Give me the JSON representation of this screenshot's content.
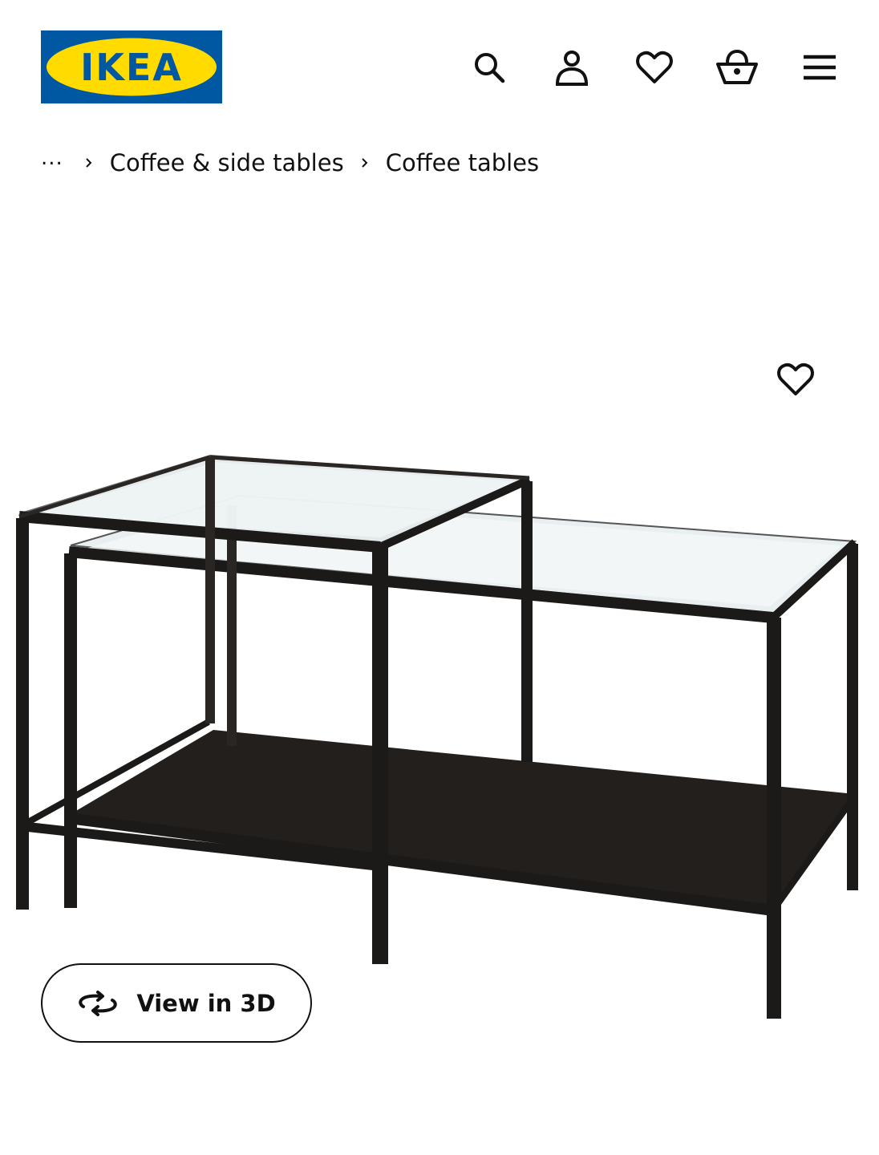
{
  "header": {
    "logo_text": "IKEA",
    "brand_colors": {
      "blue": "#0058a3",
      "yellow": "#ffdb00"
    },
    "icons": [
      "search-icon",
      "account-icon",
      "heart-icon",
      "basket-icon",
      "menu-icon"
    ]
  },
  "breadcrumb": {
    "ellipsis": "...",
    "items": [
      {
        "label": "Coffee & side tables"
      },
      {
        "label": "Coffee tables"
      }
    ]
  },
  "product": {
    "view3d_label": "View in 3D",
    "favourite_icon": "heart-outline-icon",
    "view3d_icon": "rotate-icon"
  }
}
